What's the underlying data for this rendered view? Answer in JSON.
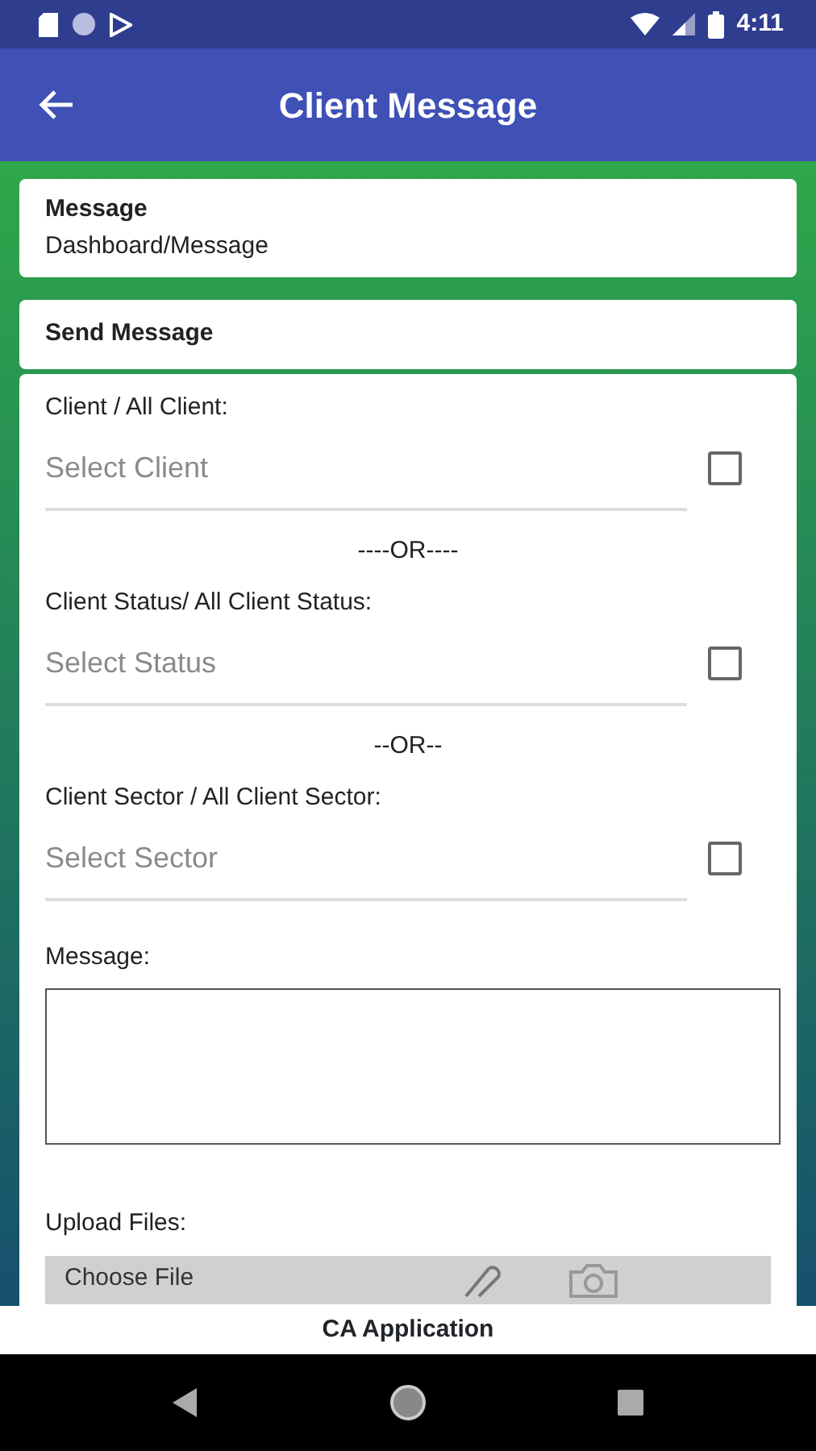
{
  "status_bar": {
    "time": "4:11"
  },
  "app_bar": {
    "title": "Client Message"
  },
  "breadcrumb_card": {
    "title": "Message",
    "path": "Dashboard/Message"
  },
  "section_title": "Send Message",
  "selectors": [
    {
      "label": "Client / All Client:",
      "placeholder": "Select Client",
      "checked": false,
      "separator": "----OR----"
    },
    {
      "label": "Client Status/ All Client Status:",
      "placeholder": "Select Status",
      "checked": false,
      "separator": "--OR--"
    },
    {
      "label": "Client Sector / All Client Sector:",
      "placeholder": "Select Sector",
      "checked": false
    }
  ],
  "message": {
    "label": "Message:"
  },
  "upload": {
    "label": "Upload Files:",
    "button": "Choose File"
  },
  "footer": "CA Application"
}
